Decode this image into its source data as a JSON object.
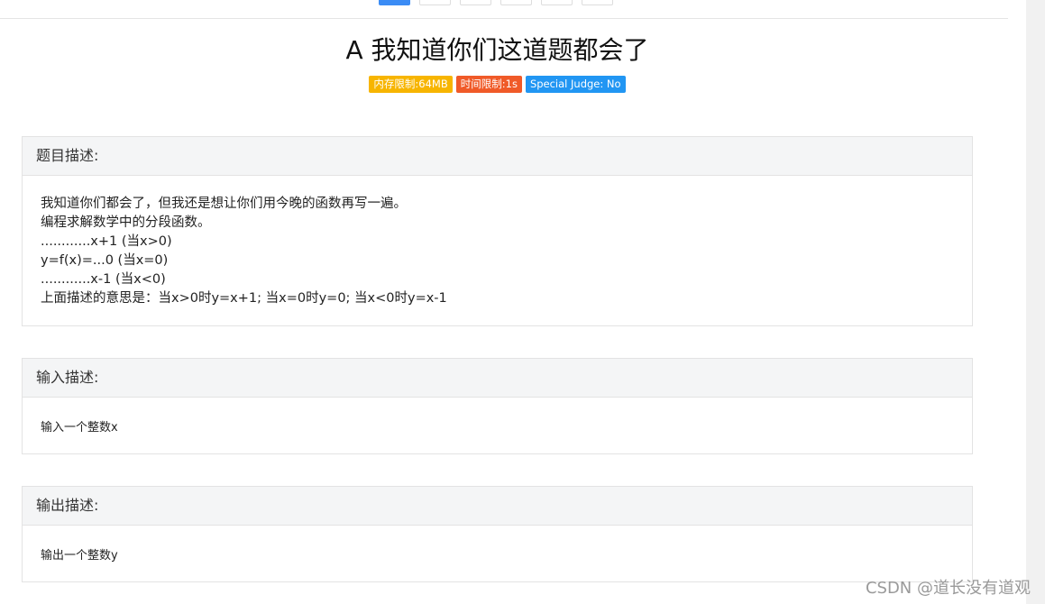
{
  "problem": {
    "title": "A 我知道你们这道题都会了",
    "badges": [
      {
        "label": "内存限制:64MB",
        "color": "#f7b500"
      },
      {
        "label": "时间限制:1s",
        "color": "#f05a28"
      },
      {
        "label": "Special Judge: No",
        "color": "#2196f3"
      }
    ]
  },
  "sections": {
    "description": {
      "heading": "题目描述:",
      "lines": [
        "我知道你们都会了，但我还是想让你们用今晚的函数再写一遍。",
        "编程求解数学中的分段函数。",
        "............x+1 (当x>0)",
        "y=f(x)=...0 (当x=0)",
        "............x-1 (当x<0)",
        "上面描述的意思是：当x>0时y=x+1; 当x=0时y=0; 当x<0时y=x-1"
      ]
    },
    "input": {
      "heading": "输入描述:",
      "text": "输入一个整数x"
    },
    "output": {
      "heading": "输出描述:",
      "text": "输出一个整数y"
    }
  },
  "watermark": "CSDN @道长没有道观",
  "colors": {
    "active_tab": "#3b8cf5",
    "panel_heading_bg": "#f4f5f6"
  }
}
